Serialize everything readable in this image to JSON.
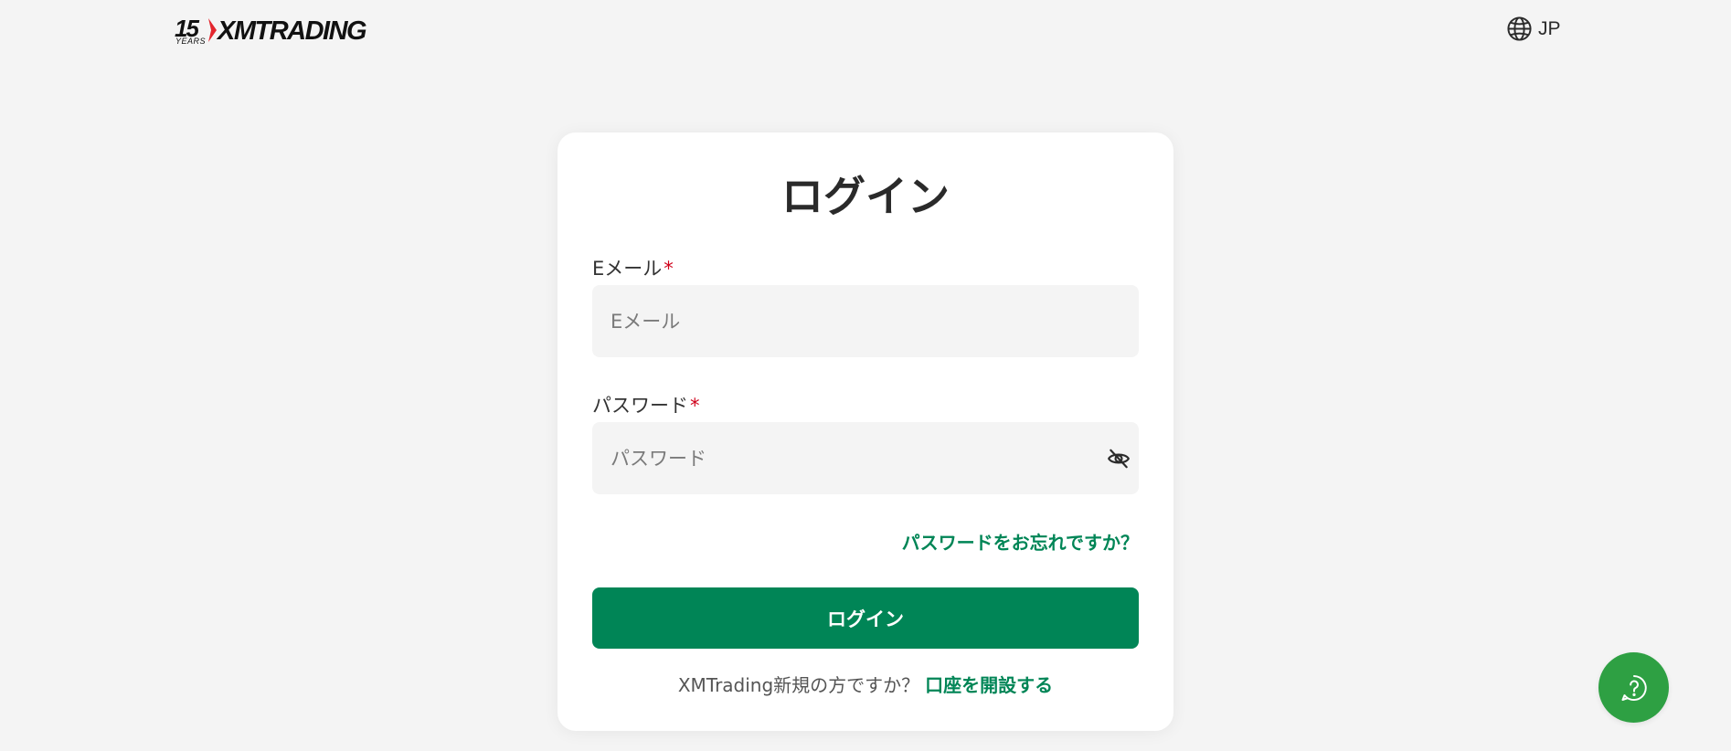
{
  "header": {
    "logo": {
      "years_number": "15",
      "years_label": "YEARS",
      "brand": "XMTRADING"
    },
    "language": {
      "icon": "globe-icon",
      "label": "JP"
    }
  },
  "login_card": {
    "title": "ログイン",
    "email": {
      "label": "Eメール",
      "required_mark": "*",
      "placeholder": "Eメール",
      "value": ""
    },
    "password": {
      "label": "パスワード",
      "required_mark": "*",
      "placeholder": "パスワード",
      "value": "",
      "toggle_icon": "eye-off-icon"
    },
    "forgot_password_link": "パスワードをお忘れですか？",
    "submit_label": "ログイン",
    "signup_prompt": "XMTrading新規の方ですか？",
    "signup_link": "口座を開設する"
  },
  "help_bubble": {
    "icon": "help-chat-icon"
  },
  "colors": {
    "background": "#f4f4f4",
    "card": "#ffffff",
    "accent_green": "#008556",
    "help_green": "#2ea043",
    "required_red": "#d0021b",
    "logo_red": "#e3262e"
  }
}
